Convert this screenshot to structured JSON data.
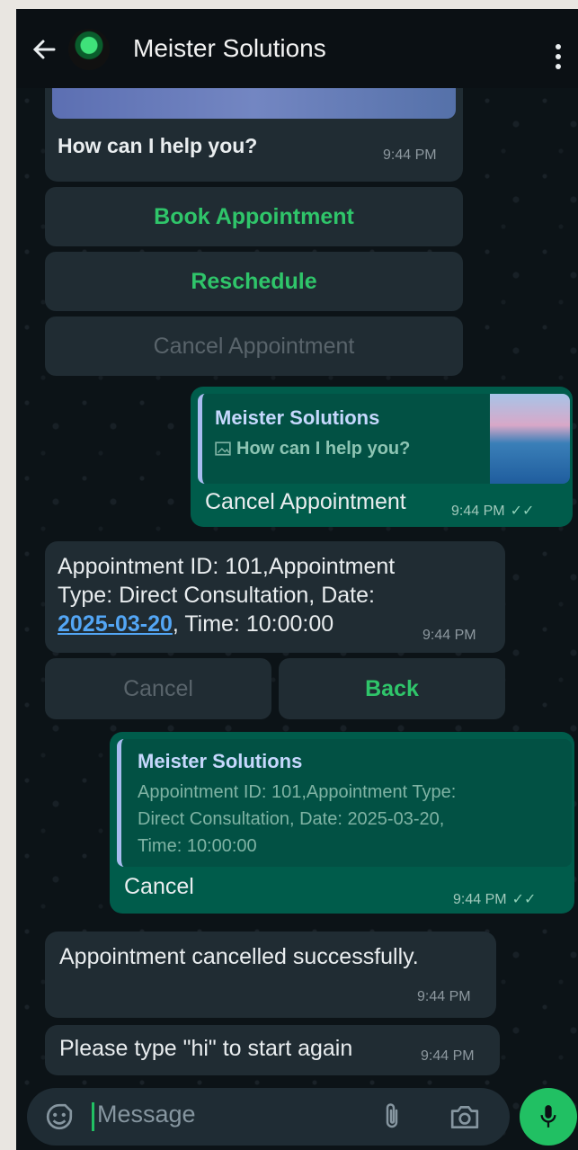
{
  "header": {
    "title": "Meister Solutions"
  },
  "messages": {
    "menu": {
      "text": "How can I help you?",
      "time": "9:44 PM"
    },
    "menu_buttons": [
      "Book Appointment",
      "Reschedule",
      "Cancel Appointment"
    ],
    "reply1": {
      "quote_name": "Meister Solutions",
      "quote_text": "How can I help you?",
      "text": "Cancel Appointment",
      "time": "9:44 PM"
    },
    "details": {
      "line1": "Appointment ID: 101,Appointment",
      "line2": "Type: Direct Consultation, Date:",
      "date": "2025-03-20",
      "time_text": ", Time: 10:00:00",
      "time": "9:44 PM"
    },
    "detail_buttons": [
      "Cancel",
      "Back"
    ],
    "reply2": {
      "quote_name": "Meister Solutions",
      "quote_line1": "Appointment ID: 101,Appointment Type:",
      "quote_line2": "Direct Consultation, Date: 2025-03-20,",
      "quote_line3": "Time: 10:00:00",
      "text": "Cancel",
      "time": "9:44 PM"
    },
    "success": {
      "text": "Appointment cancelled successfully.",
      "time": "9:44 PM"
    },
    "restart": {
      "text": "Please type \"hi\" to start again",
      "time": "9:44 PM"
    }
  },
  "composer": {
    "placeholder": "Message"
  },
  "colors": {
    "accent": "#21c063",
    "outgoing": "#005c4b",
    "incoming": "#202c33"
  },
  "icons": [
    "back-arrow-icon",
    "avatar",
    "more-vert-icon",
    "sticker-icon",
    "attach-icon",
    "camera-icon",
    "mic-icon",
    "read-ticks-icon",
    "image-icon"
  ]
}
